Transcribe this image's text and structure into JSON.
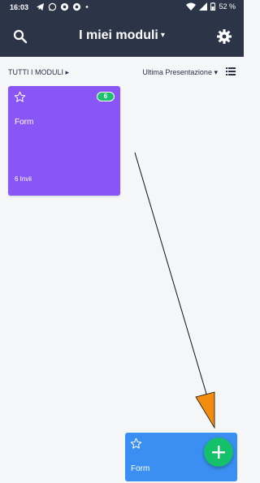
{
  "status_bar": {
    "time": "16:03",
    "battery": "52 %",
    "icons": [
      "telegram-icon",
      "whatsapp-icon",
      "chrome-icon",
      "chrome-icon",
      "dot-icon",
      "wifi-icon",
      "signal-icon",
      "battery-icon"
    ]
  },
  "header": {
    "title": "I miei moduli",
    "icons": [
      "search-icon",
      "gear-icon",
      "chevron-down-icon"
    ]
  },
  "toolbar": {
    "all_forms_label": "TUTTI I MODULI",
    "sort_label": "Ultima Presentazione"
  },
  "forms": [
    {
      "name": "Form",
      "badge": "6",
      "submissions": "6 Invii",
      "color": "#8a55f5"
    },
    {
      "name": "Form",
      "color": "#3b8ff2"
    }
  ],
  "colors": {
    "header_bg": "#2c3448",
    "page_bg": "#f5f6f8",
    "fab": "#15c06a",
    "badge": "#1fc06f",
    "annotation_arrow": "#f28c0f"
  }
}
